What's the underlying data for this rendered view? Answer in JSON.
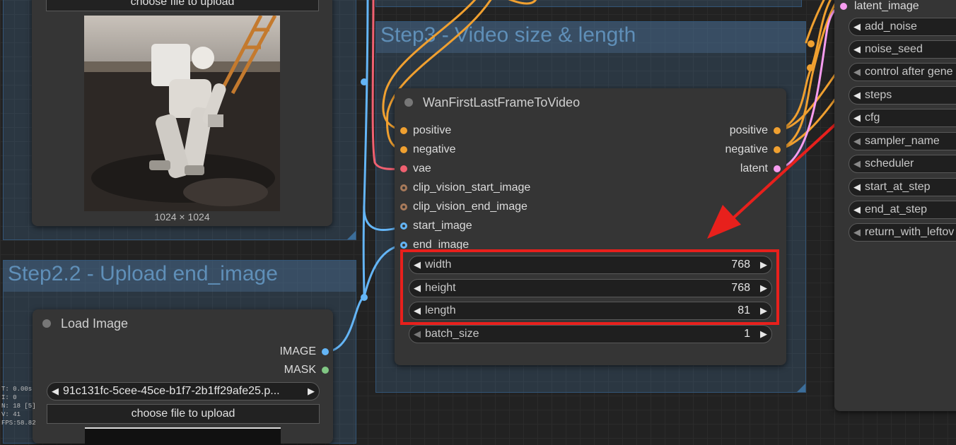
{
  "groups": {
    "step3_title": "Step3 - Video size & length",
    "step2_2_title": "Step2.2 - Upload end_image"
  },
  "top_image_node": {
    "upload_button": "choose file to upload",
    "image_size": "1024 × 1024"
  },
  "wan_node": {
    "title": "WanFirstLastFrameToVideo",
    "inputs": [
      "positive",
      "negative",
      "vae",
      "clip_vision_start_image",
      "clip_vision_end_image",
      "start_image",
      "end_image"
    ],
    "outputs": [
      "positive",
      "negative",
      "latent"
    ],
    "widgets": [
      {
        "label": "width",
        "value": "768"
      },
      {
        "label": "height",
        "value": "768"
      },
      {
        "label": "length",
        "value": "81"
      },
      {
        "label": "batch_size",
        "value": "1"
      }
    ]
  },
  "load_image_node": {
    "title": "Load Image",
    "outputs": [
      "IMAGE",
      "MASK"
    ],
    "filename": "91c131fc-5cee-45ce-b1f7-2b1ff29afe25.p...",
    "upload_button": "choose file to upload"
  },
  "sampler_node": {
    "input": "latent_image",
    "widgets": [
      "add_noise",
      "noise_seed",
      "control after gene",
      "steps",
      "cfg",
      "sampler_name",
      "scheduler",
      "start_at_step",
      "end_at_step",
      "return_with_leftov"
    ]
  },
  "stats": [
    "T: 0.00s",
    "I: 0",
    "N: 18 [5]",
    "V: 41",
    "FPS:58.82"
  ],
  "colors": {
    "highlight": "#e8201c",
    "group_title": "#5f8fb8",
    "conditioning": "#f0a030",
    "vae": "#f06070",
    "image": "#64b5f6",
    "latent": "#f79cf0",
    "mask": "#81c784"
  }
}
